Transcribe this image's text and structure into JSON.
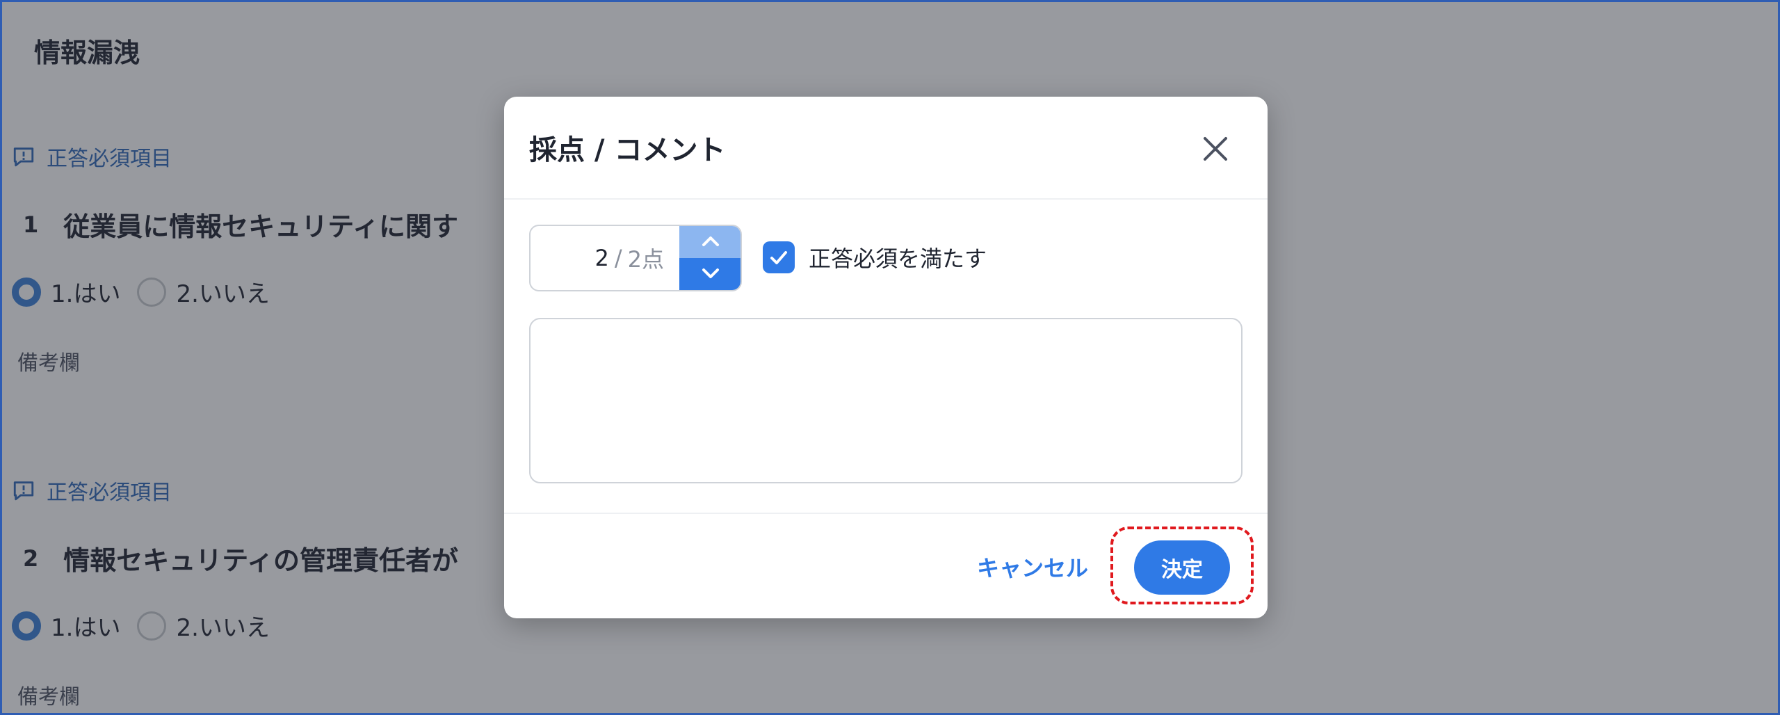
{
  "page": {
    "title": "情報漏洩"
  },
  "questions": [
    {
      "required_label": "正答必須項目",
      "number": "1",
      "text": "従業員に情報セキュリティに関す",
      "options": [
        {
          "label": "1.はい",
          "checked": true
        },
        {
          "label": "2.いいえ",
          "checked": false
        }
      ],
      "note_label": "備考欄"
    },
    {
      "required_label": "正答必須項目",
      "number": "2",
      "text": "情報セキュリティの管理責任者が",
      "options": [
        {
          "label": "1.はい",
          "checked": true
        },
        {
          "label": "2.いいえ",
          "checked": false
        }
      ],
      "note_label": "備考欄"
    }
  ],
  "dialog": {
    "title": "採点 / コメント",
    "score": {
      "value": "2",
      "separator": "/",
      "max": "2点"
    },
    "checkbox_label": "正答必須を満たす",
    "checkbox_checked": true,
    "comment_value": "",
    "cancel_label": "キャンセル",
    "confirm_label": "決定"
  },
  "colors": {
    "accent": "#2f7ae6",
    "highlight": "#e0191e",
    "required": "#2f69b8"
  }
}
